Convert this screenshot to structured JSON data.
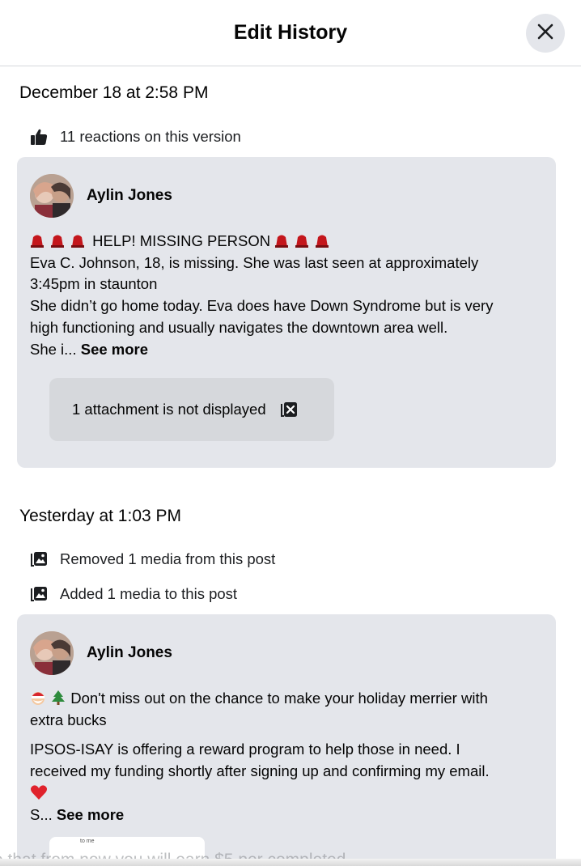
{
  "header": {
    "title": "Edit History",
    "close_icon": "close-icon"
  },
  "versions": [
    {
      "date": "December 18 at 2:58 PM",
      "meta": [
        {
          "icon": "thumbs-up-icon",
          "text": "11 reactions on this version"
        }
      ],
      "author": {
        "name": "Aylin Jones"
      },
      "lines": [
        "HELP! MISSING PERSON",
        "Eva C. Johnson, 18, is missing. She was last seen at approximately",
        "3:45pm in staunton",
        "She didn’t go home today. Eva does have Down Syndrome but is very",
        "high functioning and usually navigates the downtown area well."
      ],
      "truncated": "She i...",
      "see_more": "See more",
      "attachment_notice": "1 attachment is not displayed",
      "emoji_icon": "siren-icon"
    },
    {
      "date": "Yesterday at 1:03 PM",
      "meta": [
        {
          "icon": "photo-icon",
          "text": "Removed 1 media from this post"
        },
        {
          "icon": "photo-icon",
          "text": "Added 1 media to this post"
        }
      ],
      "author": {
        "name": "Aylin Jones"
      },
      "lines": [
        "Don't miss out on the chance to make your holiday merrier with",
        "extra bucks",
        "IPSOS-ISAY is offering a reward program to help those in need. I",
        "received my funding shortly after signing up and confirming my email."
      ],
      "truncated": "S...",
      "see_more": "See more",
      "thumb_text": "to me",
      "emoji_icons": [
        "santa-icon",
        "christmas-tree-icon",
        "red-heart-icon"
      ]
    }
  ],
  "bleed_text": "e that from now you will earn $5 per completed"
}
